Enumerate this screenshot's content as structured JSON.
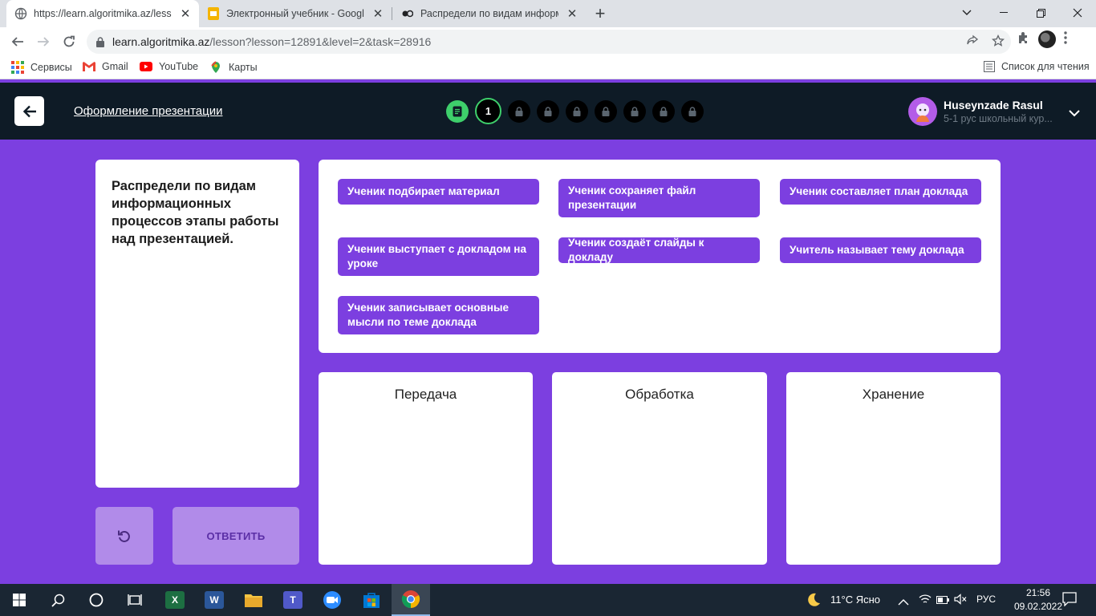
{
  "browser": {
    "tabs": [
      {
        "title": "https://learn.algoritmika.az/lesso",
        "active": true
      },
      {
        "title": "Электронный учебник - Google",
        "active": false
      },
      {
        "title": "Распредели по видам информа",
        "active": false
      }
    ],
    "url_host": "learn.algoritmika.az",
    "url_path": "/lesson?lesson=12891&level=2&task=28916",
    "bookmarks": [
      {
        "label": "Сервисы",
        "icon": "apps-grid-icon"
      },
      {
        "label": "Gmail",
        "icon": "gmail-icon"
      },
      {
        "label": "YouTube",
        "icon": "youtube-icon"
      },
      {
        "label": "Карты",
        "icon": "maps-icon"
      }
    ],
    "reading_list": "Список для чтения"
  },
  "header": {
    "lesson_title": "Оформление презентации",
    "current_step": "1",
    "locked_steps": 7,
    "user_name": "Huseynzade Rasul",
    "user_course": "5-1 рус школьный кур..."
  },
  "task": {
    "prompt": "Распредели по видам информационных процессов этапы работы над презентацией.",
    "answer_label": "ОТВЕТИТЬ"
  },
  "items": [
    "Ученик подбирает материал",
    "Ученик сохраняет файл презентации",
    "Ученик составляет план доклада",
    "Ученик выступает с  докладом на уроке",
    "Ученик создаёт слайды к докладу",
    "Учитель называет тему доклада",
    "Ученик записывает основные мысли по теме доклада"
  ],
  "categories": [
    "Передача",
    "Обработка",
    "Хранение"
  ],
  "taskbar": {
    "weather": "11°C  Ясно",
    "language": "РУС",
    "time": "21:56",
    "date": "09.02.2022"
  },
  "colors": {
    "app_bg": "#7c3fe0",
    "header_bg": "#0e1b26",
    "accent_green": "#3ecf6b",
    "button_disabled": "#b18be9"
  }
}
